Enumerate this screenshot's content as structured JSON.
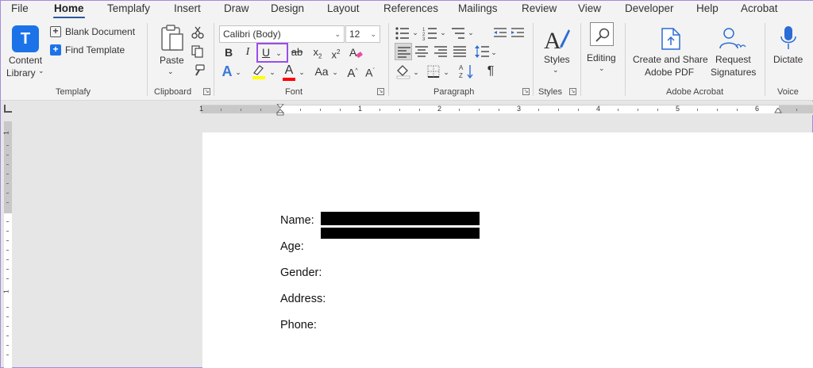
{
  "tabs": [
    "File",
    "Home",
    "Templafy",
    "Insert",
    "Draw",
    "Design",
    "Layout",
    "References",
    "Mailings",
    "Review",
    "View",
    "Developer",
    "Help",
    "Acrobat"
  ],
  "templafy": {
    "logo_letter": "T",
    "content_library_line1": "Content",
    "content_library_line2": "Library",
    "blank_document": "Blank Document",
    "find_template": "Find Template",
    "group_label": "Templafy"
  },
  "clipboard": {
    "paste": "Paste",
    "group_label": "Clipboard"
  },
  "font": {
    "name": "Calibri (Body)",
    "size": "12",
    "bold": "B",
    "italic": "I",
    "underline": "U",
    "strike": "ab",
    "subscript": "x",
    "superscript": "x",
    "text_effects": "A",
    "font_color": "A",
    "change_case": "Aa",
    "grow": "A",
    "shrink": "A",
    "group_label": "Font"
  },
  "paragraph": {
    "pilcrow": "¶",
    "group_label": "Paragraph"
  },
  "styles": {
    "label": "Styles",
    "group_label": "Styles"
  },
  "editing": {
    "label": "Editing"
  },
  "acrobat": {
    "create_line1": "Create and Share",
    "create_line2": "Adobe PDF",
    "request_line1": "Request",
    "request_line2": "Signatures",
    "group_label": "Adobe Acrobat"
  },
  "voice": {
    "dictate": "Dictate",
    "group_label": "Voice"
  },
  "ruler": {
    "numbers": [
      "1",
      "1",
      "2",
      "3",
      "4",
      "5",
      "6"
    ]
  },
  "vruler": {
    "numbers": [
      "1",
      "1"
    ]
  },
  "document": {
    "fields": [
      "Name:",
      "Age:",
      "Gender:",
      "Address:",
      "Phone:"
    ]
  },
  "colors": {
    "accent": "#2b579a",
    "highlight_box": "#9a4df0",
    "highlighter": "#ffff00",
    "font_color": "#ff0000",
    "templafy_blue": "#1c73e8"
  }
}
